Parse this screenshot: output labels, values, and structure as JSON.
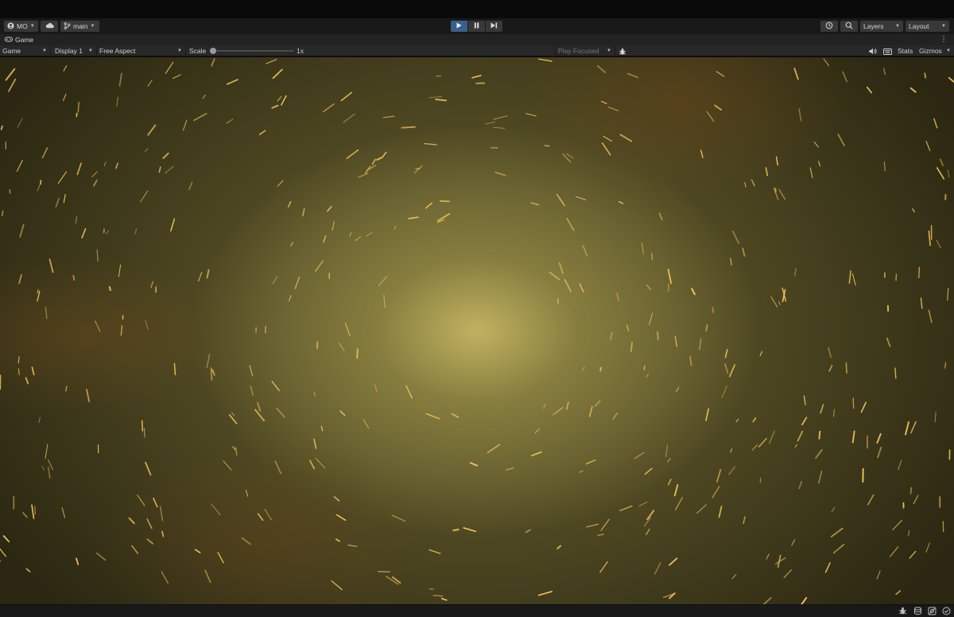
{
  "toolbar": {
    "account_label": "MO",
    "account_icon": "account-icon",
    "cloud_icon": "cloud-icon",
    "branch_label": "main",
    "branch_icon": "branch-icon",
    "play_icon": "▶",
    "pause_icon": "❚❚",
    "step_icon": "▶|",
    "history_icon": "history-icon",
    "search_icon": "search-icon",
    "layers_label": "Layers",
    "layout_label": "Layout"
  },
  "tab": {
    "label": "Game",
    "icon": "gamepad-icon",
    "menu_icon": "⋮"
  },
  "game_bar": {
    "view_mode": "Game",
    "display": "Display 1",
    "aspect": "Free Aspect",
    "scale_label": "Scale",
    "scale_value": "1x",
    "scale_level": 0.0,
    "play_mode": "Play Focused",
    "bug_icon": "bug-icon",
    "audio_icon": "speaker-icon",
    "keyboard_icon": "keyboard-icon",
    "stats_label": "Stats",
    "gizmos_label": "Gizmos"
  },
  "status_bar": {
    "icons": [
      "debug-icon",
      "layers-db-icon",
      "cache-icon",
      "check-icon"
    ]
  },
  "colors": {
    "accent_play": "#3b5f8d",
    "toolbar_bg": "#191919",
    "panel_bg": "#282828",
    "viewport_center": "#c4b662",
    "viewport_edge": "#2b2712",
    "spark": "#f2c25a"
  }
}
